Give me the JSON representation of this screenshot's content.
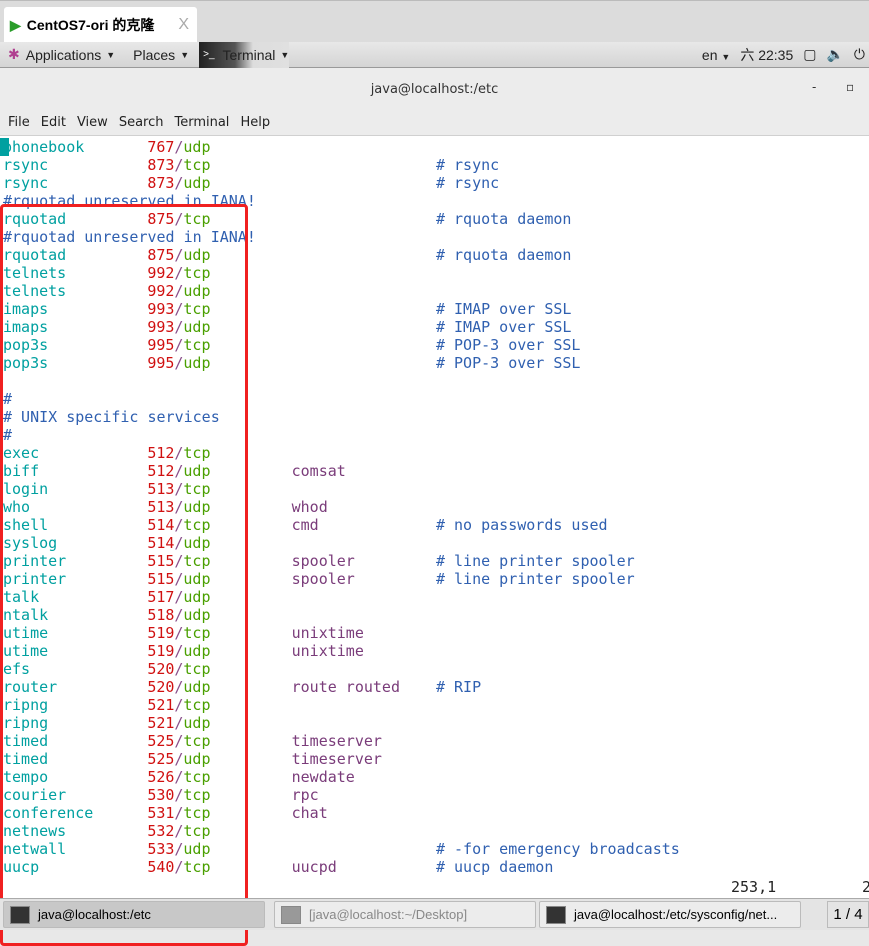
{
  "vm_tab": {
    "title": "CentOS7-ori 的克隆",
    "close": "X"
  },
  "topbar": {
    "applications": "Applications",
    "places": "Places",
    "terminal": "Terminal",
    "lang": "en",
    "clock": "六 22:35"
  },
  "window": {
    "title": "java@localhost:/etc",
    "minimize": "-",
    "maximize": "▫"
  },
  "menu": [
    "File",
    "Edit",
    "View",
    "Search",
    "Terminal",
    "Help"
  ],
  "colors": {
    "service": "#00a0a0",
    "port": "#d01010",
    "protocol": "#4aa000",
    "alias": "#7a3c7a",
    "comment": "#3060b0",
    "highlight_box": "#f02020"
  },
  "lines": [
    [
      "phonebook",
      "767",
      "udp",
      "",
      ""
    ],
    [
      "rsync",
      "873",
      "tcp",
      "",
      "# rsync"
    ],
    [
      "rsync",
      "873",
      "udp",
      "",
      "# rsync"
    ],
    {
      "comment": "#rquotad unreserved in IANA!"
    },
    [
      "rquotad",
      "875",
      "tcp",
      "",
      "# rquota daemon"
    ],
    {
      "comment": "#rquotad unreserved in IANA!"
    },
    [
      "rquotad",
      "875",
      "udp",
      "",
      "# rquota daemon"
    ],
    [
      "telnets",
      "992",
      "tcp",
      "",
      ""
    ],
    [
      "telnets",
      "992",
      "udp",
      "",
      ""
    ],
    [
      "imaps",
      "993",
      "tcp",
      "",
      "# IMAP over SSL"
    ],
    [
      "imaps",
      "993",
      "udp",
      "",
      "# IMAP over SSL"
    ],
    [
      "pop3s",
      "995",
      "tcp",
      "",
      "# POP-3 over SSL"
    ],
    [
      "pop3s",
      "995",
      "udp",
      "",
      "# POP-3 over SSL"
    ],
    {
      "comment": ""
    },
    {
      "comment": "#"
    },
    {
      "comment": "# UNIX specific services"
    },
    {
      "comment": "#"
    },
    [
      "exec",
      "512",
      "tcp",
      "",
      ""
    ],
    [
      "biff",
      "512",
      "udp",
      "comsat",
      ""
    ],
    [
      "login",
      "513",
      "tcp",
      "",
      ""
    ],
    [
      "who",
      "513",
      "udp",
      "whod",
      ""
    ],
    [
      "shell",
      "514",
      "tcp",
      "cmd",
      "# no passwords used"
    ],
    [
      "syslog",
      "514",
      "udp",
      "",
      ""
    ],
    [
      "printer",
      "515",
      "tcp",
      "spooler",
      "# line printer spooler"
    ],
    [
      "printer",
      "515",
      "udp",
      "spooler",
      "# line printer spooler"
    ],
    [
      "talk",
      "517",
      "udp",
      "",
      ""
    ],
    [
      "ntalk",
      "518",
      "udp",
      "",
      ""
    ],
    [
      "utime",
      "519",
      "tcp",
      "unixtime",
      ""
    ],
    [
      "utime",
      "519",
      "udp",
      "unixtime",
      ""
    ],
    [
      "efs",
      "520",
      "tcp",
      "",
      ""
    ],
    [
      "router",
      "520",
      "udp",
      "route routed",
      "# RIP"
    ],
    [
      "ripng",
      "521",
      "tcp",
      "",
      ""
    ],
    [
      "ripng",
      "521",
      "udp",
      "",
      ""
    ],
    [
      "timed",
      "525",
      "tcp",
      "timeserver",
      ""
    ],
    [
      "timed",
      "525",
      "udp",
      "timeserver",
      ""
    ],
    [
      "tempo",
      "526",
      "tcp",
      "newdate",
      ""
    ],
    [
      "courier",
      "530",
      "tcp",
      "rpc",
      ""
    ],
    [
      "conference",
      "531",
      "tcp",
      "chat",
      ""
    ],
    [
      "netnews",
      "532",
      "tcp",
      "",
      ""
    ],
    [
      "netwall",
      "533",
      "udp",
      "",
      "# -for emergency broadcasts"
    ],
    [
      "uucp",
      "540",
      "tcp",
      "uucpd",
      "# uucp daemon"
    ]
  ],
  "status": {
    "position": "253,1",
    "percent": "2"
  },
  "taskbar": {
    "tasks": [
      "java@localhost:/etc",
      "[java@localhost:~/Desktop]",
      "java@localhost:/etc/sysconfig/net..."
    ],
    "pager": "1 / 4"
  }
}
